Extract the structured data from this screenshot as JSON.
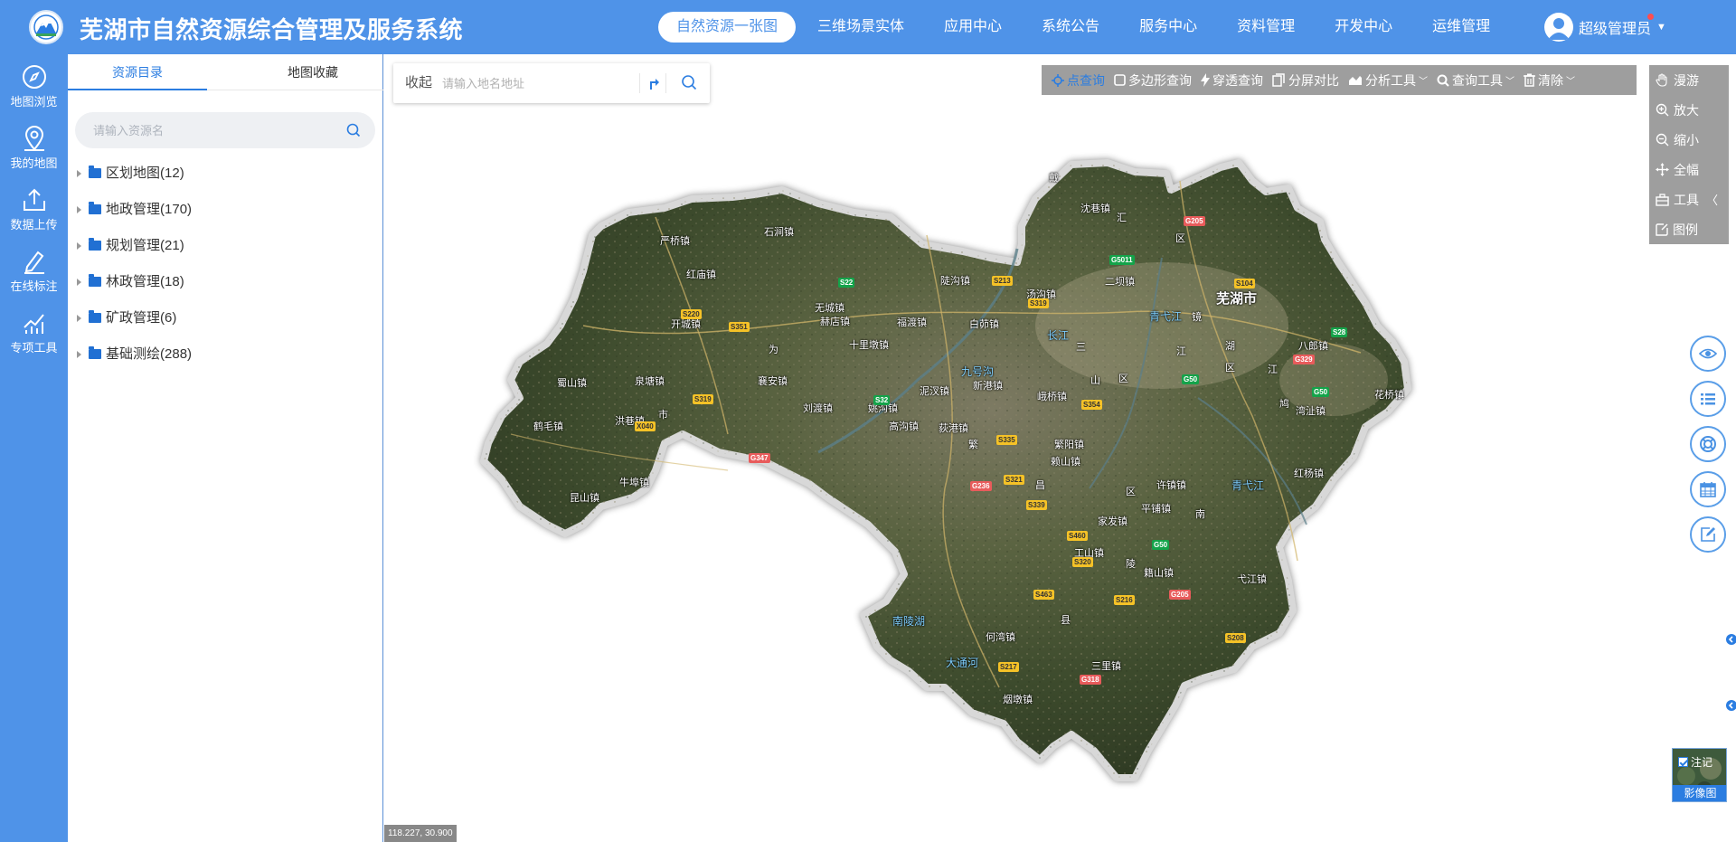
{
  "header": {
    "title": "芜湖市自然资源综合管理及服务系统",
    "nav": [
      {
        "label": "自然资源一张图",
        "active": true
      },
      {
        "label": "三维场景实体"
      },
      {
        "label": "应用中心"
      },
      {
        "label": "系统公告"
      },
      {
        "label": "服务中心"
      },
      {
        "label": "资料管理"
      },
      {
        "label": "开发中心"
      },
      {
        "label": "运维管理"
      }
    ],
    "user": "超级管理员"
  },
  "rail": [
    {
      "label": "地图浏览",
      "icon": "compass-icon"
    },
    {
      "label": "我的地图",
      "icon": "map-pin-icon"
    },
    {
      "label": "数据上传",
      "icon": "upload-icon"
    },
    {
      "label": "在线标注",
      "icon": "pen-icon"
    },
    {
      "label": "专项工具",
      "icon": "chart-icon"
    }
  ],
  "panel": {
    "tabs": [
      "资源目录",
      "地图收藏"
    ],
    "search_placeholder": "请输入资源名",
    "tree": [
      {
        "label": "区划地图",
        "count": "(12)"
      },
      {
        "label": "地政管理",
        "count": "(170)"
      },
      {
        "label": "规划管理",
        "count": "(21)"
      },
      {
        "label": "林政管理",
        "count": "(18)"
      },
      {
        "label": "矿政管理",
        "count": "(6)"
      },
      {
        "label": "基础测绘",
        "count": "(288)"
      }
    ]
  },
  "map": {
    "collapse_label": "收起",
    "address_placeholder": "请输入地名地址",
    "toolbar": [
      {
        "label": "点查询",
        "icon": "crosshair-icon",
        "active": true
      },
      {
        "label": "多边形查询",
        "icon": "square-icon"
      },
      {
        "label": "穿透查询",
        "icon": "bolt-icon"
      },
      {
        "label": "分屏对比",
        "icon": "split-icon"
      },
      {
        "label": "分析工具",
        "icon": "area-chart-icon",
        "dropdown": true
      },
      {
        "label": "查询工具",
        "icon": "search-icon",
        "dropdown": true
      },
      {
        "label": "清除",
        "icon": "trash-icon",
        "dropdown": true
      }
    ],
    "right_tools": [
      {
        "label": "漫游",
        "icon": "hand-icon"
      },
      {
        "label": "放大",
        "icon": "zoom-in-icon"
      },
      {
        "label": "缩小",
        "icon": "zoom-out-icon"
      },
      {
        "label": "全幅",
        "icon": "move-icon"
      },
      {
        "label": "工具",
        "icon": "toolbox-icon"
      },
      {
        "label": "图例",
        "icon": "legend-icon"
      }
    ],
    "side_buttons": [
      "eye-icon",
      "list-icon",
      "lifebuoy-icon",
      "calendar-icon",
      "edit-icon"
    ],
    "layer_switch": {
      "annotation": "注记",
      "caption": "影像图"
    },
    "coordinates": "118.227, 30.900",
    "places": [
      {
        "t": "戴",
        "cls": ""
      },
      {
        "t": "沈巷镇",
        "cls": ""
      },
      {
        "t": "汇",
        "cls": ""
      },
      {
        "t": "区",
        "cls": ""
      },
      {
        "t": "严桥镇",
        "cls": ""
      },
      {
        "t": "石涧镇",
        "cls": ""
      },
      {
        "t": "红庙镇",
        "cls": ""
      },
      {
        "t": "陡沟镇",
        "cls": ""
      },
      {
        "t": "二坝镇",
        "cls": ""
      },
      {
        "t": "汤沟镇",
        "cls": ""
      },
      {
        "t": "芜湖市",
        "cls": "city"
      },
      {
        "t": "无城镇",
        "cls": ""
      },
      {
        "t": "开城镇",
        "cls": ""
      },
      {
        "t": "赫店镇",
        "cls": ""
      },
      {
        "t": "福渡镇",
        "cls": ""
      },
      {
        "t": "白茆镇",
        "cls": ""
      },
      {
        "t": "长江",
        "cls": "water"
      },
      {
        "t": "青弋江",
        "cls": "water"
      },
      {
        "t": "镜",
        "cls": ""
      },
      {
        "t": "八郎镇",
        "cls": ""
      },
      {
        "t": "十里墩镇",
        "cls": ""
      },
      {
        "t": "为",
        "cls": ""
      },
      {
        "t": "三",
        "cls": ""
      },
      {
        "t": "江",
        "cls": ""
      },
      {
        "t": "湖",
        "cls": ""
      },
      {
        "t": "区",
        "cls": ""
      },
      {
        "t": "鸠",
        "cls": ""
      },
      {
        "t": "江",
        "cls": ""
      },
      {
        "t": "九号沟",
        "cls": "water"
      },
      {
        "t": "新港镇",
        "cls": ""
      },
      {
        "t": "泥汊镇",
        "cls": ""
      },
      {
        "t": "蜀山镇",
        "cls": ""
      },
      {
        "t": "泉塘镇",
        "cls": ""
      },
      {
        "t": "襄安镇",
        "cls": ""
      },
      {
        "t": "山",
        "cls": ""
      },
      {
        "t": "区",
        "cls": ""
      },
      {
        "t": "湾沚镇",
        "cls": ""
      },
      {
        "t": "花桥镇",
        "cls": ""
      },
      {
        "t": "峨桥镇",
        "cls": ""
      },
      {
        "t": "姚沟镇",
        "cls": ""
      },
      {
        "t": "刘渡镇",
        "cls": ""
      },
      {
        "t": "鹤毛镇",
        "cls": ""
      },
      {
        "t": "洪巷镇",
        "cls": ""
      },
      {
        "t": "市",
        "cls": ""
      },
      {
        "t": "高沟镇",
        "cls": ""
      },
      {
        "t": "荻港镇",
        "cls": ""
      },
      {
        "t": "繁",
        "cls": ""
      },
      {
        "t": "繁阳镇",
        "cls": ""
      },
      {
        "t": "赖山镇",
        "cls": ""
      },
      {
        "t": "昌",
        "cls": ""
      },
      {
        "t": "区",
        "cls": ""
      },
      {
        "t": "许镇镇",
        "cls": ""
      },
      {
        "t": "青弋江",
        "cls": "water"
      },
      {
        "t": "红杨镇",
        "cls": ""
      },
      {
        "t": "牛埠镇",
        "cls": ""
      },
      {
        "t": "昆山镇",
        "cls": ""
      },
      {
        "t": "平铺镇",
        "cls": ""
      },
      {
        "t": "南",
        "cls": ""
      },
      {
        "t": "家发镇",
        "cls": ""
      },
      {
        "t": "工山镇",
        "cls": ""
      },
      {
        "t": "陵",
        "cls": ""
      },
      {
        "t": "籍山镇",
        "cls": ""
      },
      {
        "t": "弋江镇",
        "cls": ""
      },
      {
        "t": "南陵湖",
        "cls": "water"
      },
      {
        "t": "县",
        "cls": ""
      },
      {
        "t": "何湾镇",
        "cls": ""
      },
      {
        "t": "大通河",
        "cls": "water"
      },
      {
        "t": "三里镇",
        "cls": ""
      },
      {
        "t": "烟墩镇",
        "cls": ""
      }
    ],
    "roads": [
      {
        "t": "G205",
        "cls": "red"
      },
      {
        "t": "G5011",
        "cls": "green"
      },
      {
        "t": "S104",
        "cls": ""
      },
      {
        "t": "S213",
        "cls": ""
      },
      {
        "t": "S319",
        "cls": ""
      },
      {
        "t": "S22",
        "cls": "green"
      },
      {
        "t": "S220",
        "cls": ""
      },
      {
        "t": "S351",
        "cls": ""
      },
      {
        "t": "S28",
        "cls": "green"
      },
      {
        "t": "G329",
        "cls": "red"
      },
      {
        "t": "G50",
        "cls": "green"
      },
      {
        "t": "G50",
        "cls": "green"
      },
      {
        "t": "S319",
        "cls": ""
      },
      {
        "t": "S32",
        "cls": "green"
      },
      {
        "t": "S354",
        "cls": ""
      },
      {
        "t": "X040",
        "cls": ""
      },
      {
        "t": "S335",
        "cls": ""
      },
      {
        "t": "G347",
        "cls": "red"
      },
      {
        "t": "S321",
        "cls": ""
      },
      {
        "t": "G236",
        "cls": "red"
      },
      {
        "t": "S339",
        "cls": ""
      },
      {
        "t": "S460",
        "cls": ""
      },
      {
        "t": "G50",
        "cls": "green"
      },
      {
        "t": "S320",
        "cls": ""
      },
      {
        "t": "S463",
        "cls": ""
      },
      {
        "t": "S216",
        "cls": ""
      },
      {
        "t": "G205",
        "cls": "red"
      },
      {
        "t": "S208",
        "cls": ""
      },
      {
        "t": "S217",
        "cls": ""
      },
      {
        "t": "G318",
        "cls": "red"
      }
    ]
  },
  "colors": {
    "header": "#4f93e8",
    "accent": "#2b7de1",
    "toolbar": "#969696"
  }
}
